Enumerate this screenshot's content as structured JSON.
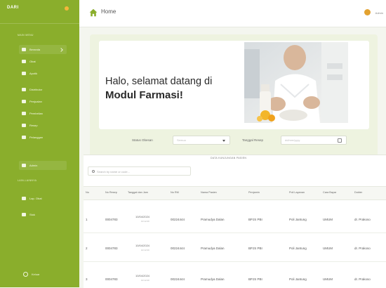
{
  "sidebar": {
    "brand": "DARI",
    "sections": [
      "MAIN MENU",
      "LAIN-LAINNYA"
    ],
    "items": [
      {
        "label": "Beranda",
        "icon": "home-icon"
      },
      {
        "label": "Obat",
        "icon": "capsule-icon"
      },
      {
        "label": "Apotik",
        "icon": "store-icon"
      },
      {
        "label": "Distributor",
        "icon": "truck-icon"
      },
      {
        "label": "Penjualan",
        "icon": "cart-icon"
      },
      {
        "label": "Pembelian",
        "icon": "bag-icon"
      },
      {
        "label": "Resep",
        "icon": "document-icon"
      },
      {
        "label": "Pelanggan",
        "icon": "users-icon"
      },
      {
        "label": "Admin",
        "icon": "user-icon"
      },
      {
        "label": "Lap. Obat",
        "icon": "chart-icon"
      },
      {
        "label": "Stok",
        "icon": "box-icon"
      }
    ],
    "logout": "Keluar"
  },
  "topbar": {
    "title": "Home",
    "user": "Admin"
  },
  "hero": {
    "line1": "Halo, selamat datang di",
    "line2": "Modul Farmasi!"
  },
  "filters": {
    "status_label": "Status Obesan",
    "status_value": "Semua",
    "date_label": "Tanggal Resep",
    "date_placeholder": "dd/mm/yyyy"
  },
  "table": {
    "caption": "DATA KUNJUNGAN PASIEN",
    "search_placeholder": "Search by name or code...",
    "headers": [
      "No",
      "No Resep",
      "Tanggal dan Jam",
      "No RM",
      "Nama Pasien",
      "Penjamin",
      "Poli Layanan",
      "Cara Bayar",
      "Dokter"
    ],
    "rows": [
      {
        "no": "1",
        "resep": "0004783",
        "tgl": "10/04/2024",
        "jam": "10:12:20",
        "rm": "00224444",
        "nama": "Pramudya Dalan",
        "penjamin": "BPJS PBI",
        "poli": "Poli Jantung",
        "bayar": "UMUM",
        "dokter": "dr. Prakoso"
      },
      {
        "no": "2",
        "resep": "0004783",
        "tgl": "10/04/2024",
        "jam": "10:12:20",
        "rm": "00224444",
        "nama": "Pramudya Dalan",
        "penjamin": "BPJS PBI",
        "poli": "Poli Jantung",
        "bayar": "UMUM",
        "dokter": "dr. Prakoso"
      },
      {
        "no": "3",
        "resep": "0004783",
        "tgl": "10/04/2024",
        "jam": "10:12:20",
        "rm": "00224444",
        "nama": "Pramudya Dalan",
        "penjamin": "BPJS PBI",
        "poli": "Poli Jantung",
        "bayar": "UMUM",
        "dokter": "dr. Prakoso"
      }
    ]
  },
  "colors": {
    "sidebar": "#8aae2c",
    "accent": "#f5b73b",
    "background": "#f4f6ef"
  }
}
